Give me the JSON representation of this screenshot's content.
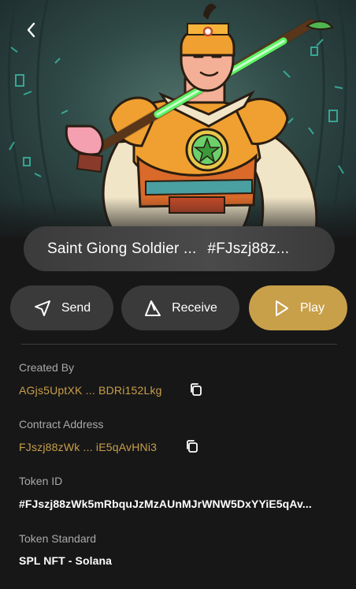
{
  "header": {
    "back_icon": "chevron-left-icon"
  },
  "nft": {
    "title": "Saint Giong Soldier ...",
    "token_short": "#FJszj88z..."
  },
  "actions": {
    "send_label": "Send",
    "receive_label": "Receive",
    "play_label": "Play",
    "send_icon": "send-arrow-icon",
    "receive_icon": "receive-arrow-icon",
    "play_icon": "play-icon"
  },
  "details": {
    "created_by_label": "Created By",
    "created_by_value": "AGjs5UptXK ... BDRi152Lkg",
    "contract_label": "Contract Address",
    "contract_value": "FJszj88zWk ... iE5qAvHNi3",
    "token_id_label": "Token ID",
    "token_id_value": "#FJszj88zWk5mRbquJzMzAUnMJrWNW5DxYYiE5qAv...",
    "standard_label": "Token Standard",
    "standard_value": "SPL NFT - Solana"
  },
  "colors": {
    "accent": "#c8a04a",
    "gold_text": "#c99f4a",
    "background": "#171717",
    "button_bg": "#3a3a3a"
  }
}
